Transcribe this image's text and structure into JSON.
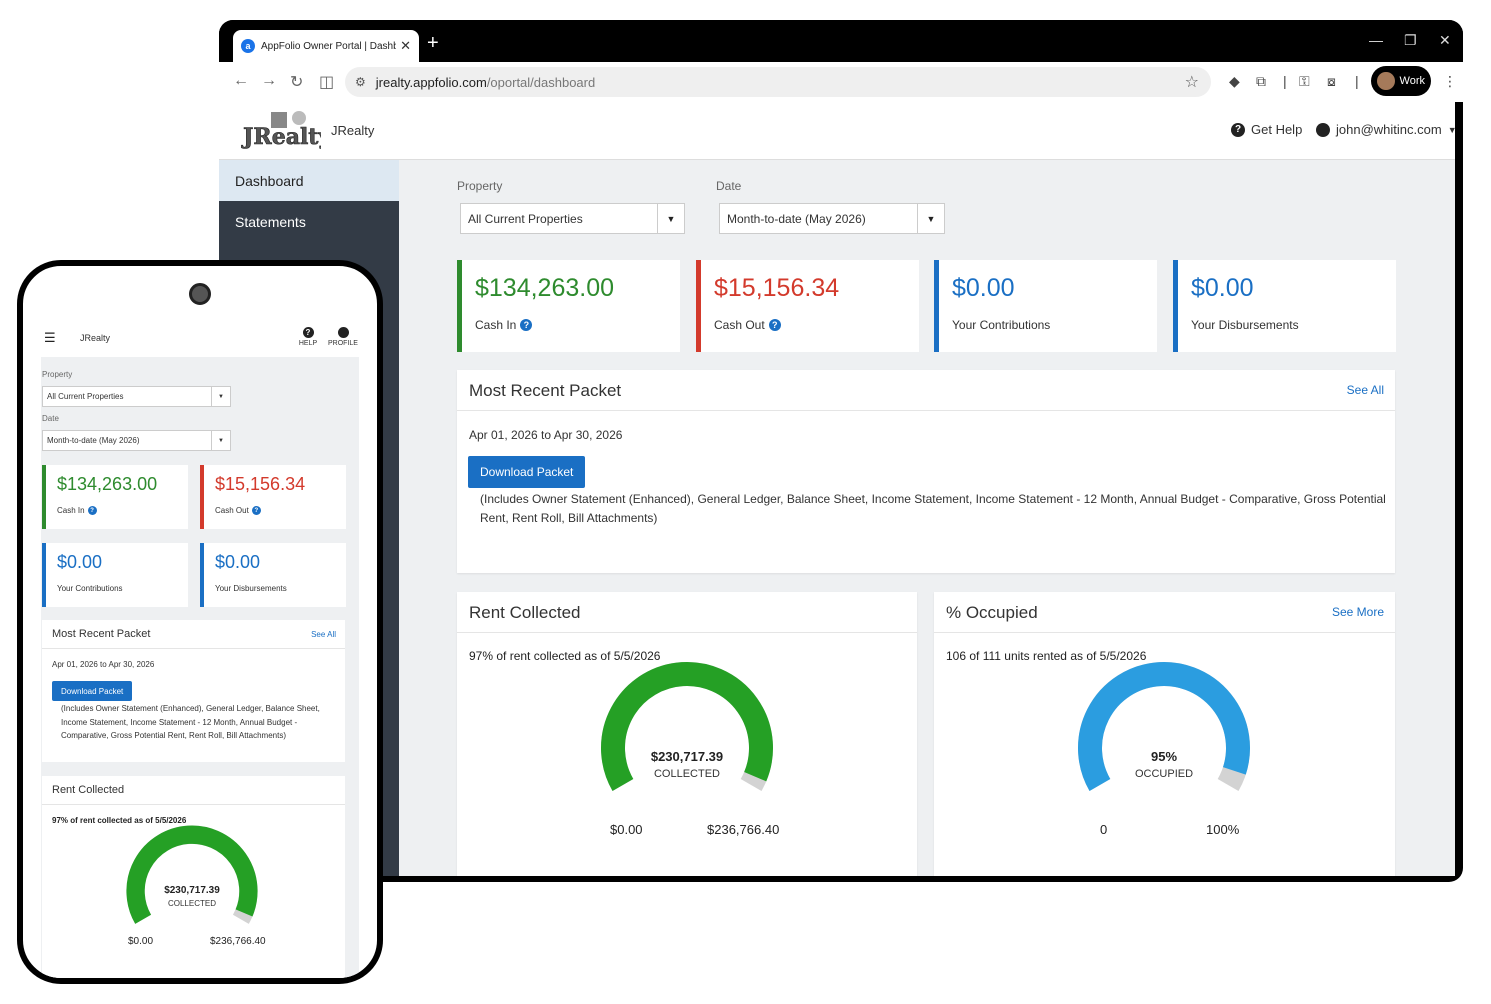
{
  "browser": {
    "tab_title": "AppFolio Owner Portal | Dashboard",
    "url_host": "jrealty.appfolio.com",
    "url_path": "/oportal/dashboard",
    "profile_label": "Work"
  },
  "header": {
    "brand": "JRealty",
    "help": "Get Help",
    "user": "john@whitinc.com"
  },
  "sidebar": {
    "items": [
      {
        "label": "Dashboard",
        "active": true
      },
      {
        "label": "Statements",
        "active": false
      }
    ]
  },
  "filters": {
    "property_label": "Property",
    "property_value": "All Current Properties",
    "date_label": "Date",
    "date_value": "Month-to-date (May 2026)"
  },
  "stats": [
    {
      "amount": "$134,263.00",
      "label": "Cash In",
      "color": "#2e8b2e",
      "info": true
    },
    {
      "amount": "$15,156.34",
      "label": "Cash Out",
      "color": "#d33a2c",
      "info": true
    },
    {
      "amount": "$0.00",
      "label": "Your Contributions",
      "color": "#1a6fc4",
      "info": false
    },
    {
      "amount": "$0.00",
      "label": "Your Disbursements",
      "color": "#1a6fc4",
      "info": false
    }
  ],
  "packet": {
    "title": "Most Recent Packet",
    "see_all": "See All",
    "range": "Apr 01, 2026 to Apr 30, 2026",
    "download": "Download Packet",
    "includes": "(Includes Owner Statement (Enhanced), General Ledger, Balance Sheet, Income Statement, Income Statement - 12 Month, Annual Budget - Comparative, Gross Potential Rent, Rent Roll, Bill Attachments)"
  },
  "rent": {
    "title": "Rent Collected",
    "subtitle": "97% of rent collected as of 5/5/2026",
    "value": "$230,717.39",
    "caption": "COLLECTED",
    "min": "$0.00",
    "max": "$236,766.40",
    "fraction": 0.97,
    "color": "#25a025"
  },
  "occupied": {
    "title": "% Occupied",
    "see_more": "See More",
    "subtitle": "106 of 111 units rented as of 5/5/2026",
    "value": "95%",
    "caption": "OCCUPIED",
    "min": "0",
    "max": "100%",
    "fraction": 0.95,
    "color": "#2b9de0"
  },
  "mobile": {
    "brand": "JRealty",
    "help": "HELP",
    "profile": "PROFILE"
  },
  "colors": {
    "primary": "#1a6fc4",
    "sidebar": "#333b46",
    "gauge_track": "#d3d3d3"
  }
}
